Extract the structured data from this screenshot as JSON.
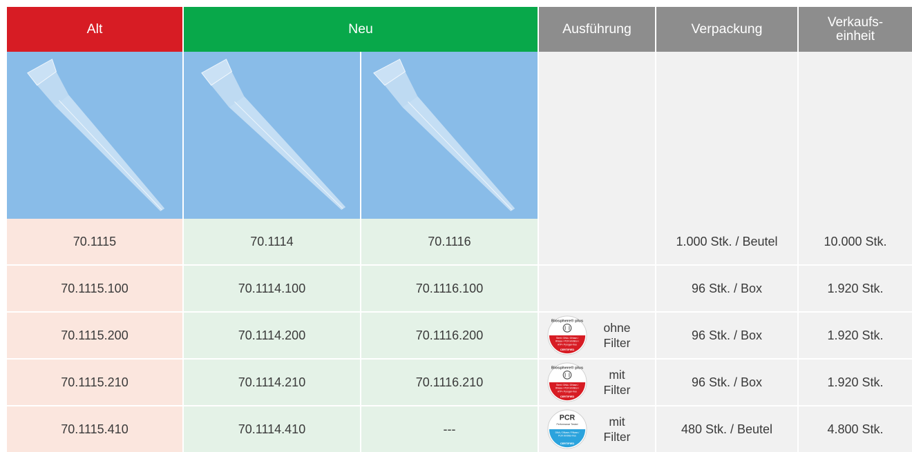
{
  "header": {
    "alt": "Alt",
    "neu": "Neu",
    "ausfuehrung": "Ausführung",
    "verpackung": "Verpackung",
    "ve_line1": "Verkaufs-",
    "ve_line2": "einheit"
  },
  "colors": {
    "alt_header": "#d71c24",
    "neu_header": "#08a84a",
    "gray_header": "#8d8d8d",
    "image_bg": "#89bce8",
    "alt_cell": "#fbe6de",
    "neu_cell": "#e4f2e7",
    "gray_cell": "#f1f1f1"
  },
  "rows": [
    {
      "alt": "70.1115",
      "neu1": "70.1114",
      "neu2": "70.1116",
      "badge": "",
      "ausf1": "",
      "ausf2": "",
      "verpackung": "1.000 Stk. / Beutel",
      "ve": "10.000 Stk."
    },
    {
      "alt": "70.1115.100",
      "neu1": "70.1114.100",
      "neu2": "70.1116.100",
      "badge": "",
      "ausf1": "",
      "ausf2": "",
      "verpackung": "96 Stk. / Box",
      "ve": "1.920 Stk."
    },
    {
      "alt": "70.1115.200",
      "neu1": "70.1114.200",
      "neu2": "70.1116.200",
      "badge": "biosphere-plus-badge",
      "ausf1": "ohne",
      "ausf2": "Filter",
      "verpackung": "96 Stk. / Box",
      "ve": "1.920 Stk."
    },
    {
      "alt": "70.1115.210",
      "neu1": "70.1114.210",
      "neu2": "70.1116.210",
      "badge": "biosphere-plus-badge",
      "ausf1": "mit",
      "ausf2": "Filter",
      "verpackung": "96 Stk. / Box",
      "ve": "1.920 Stk."
    },
    {
      "alt": "70.1115.410",
      "neu1": "70.1114.410",
      "neu2": "---",
      "badge": "pcr-performance-badge",
      "ausf1": "mit",
      "ausf2": "Filter",
      "verpackung": "480 Stk. / Beutel",
      "ve": "4.800 Stk."
    }
  ],
  "badges": {
    "biosphere": {
      "top": "Biosphere® plus",
      "mid1": "Steril / DNA-/ DNase-/",
      "mid2": "RNase-/ PCR inhibitor-/",
      "mid3": "ATP-/ Pyrogen-free",
      "bottom": "CERTIFIED"
    },
    "pcr": {
      "top": "PCR",
      "sub": "Performance Tested",
      "mid1": "DNA-/ DNase-/ RNase-/",
      "mid2": "PCR inhibitor-free",
      "bottom": "CERTIFIED"
    }
  }
}
